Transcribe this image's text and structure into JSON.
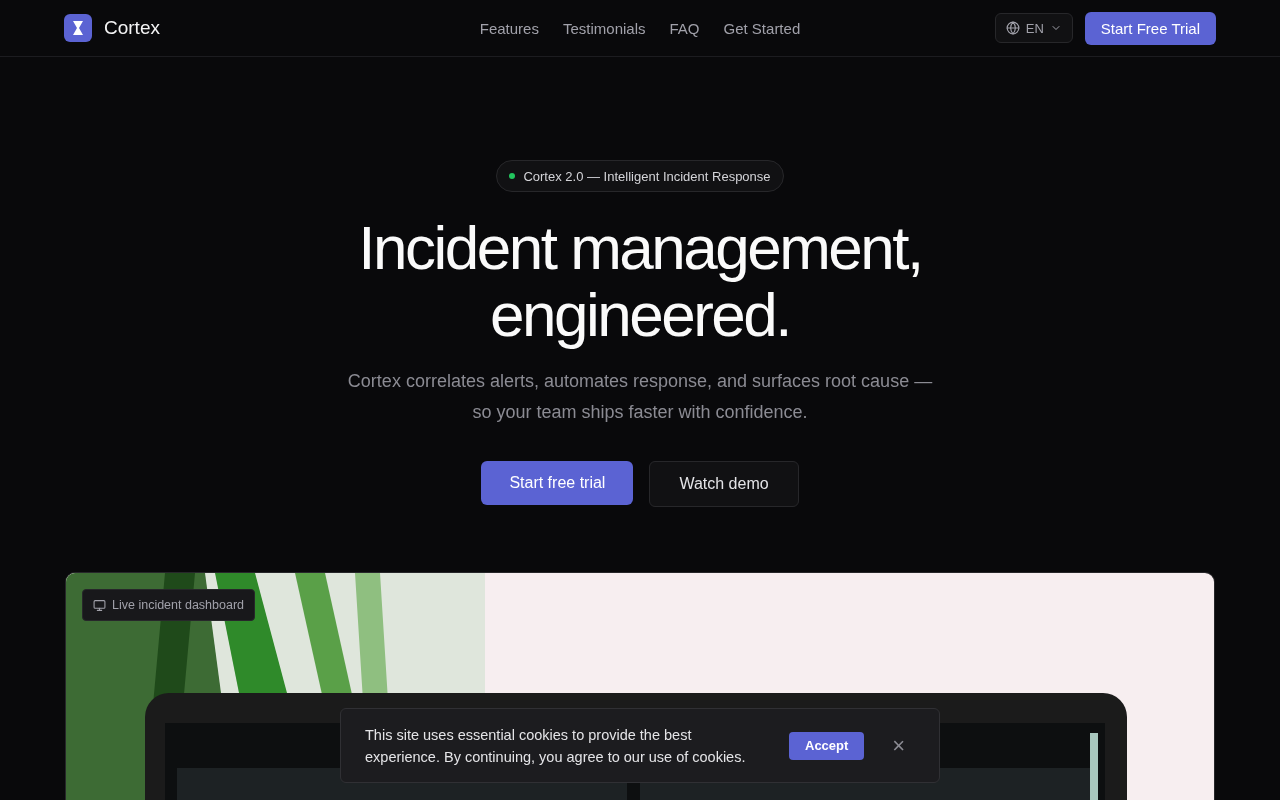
{
  "nav": {
    "brand": "Cortex",
    "links": [
      {
        "label": "Features"
      },
      {
        "label": "Testimonials"
      },
      {
        "label": "FAQ"
      },
      {
        "label": "Get Started"
      }
    ],
    "language": "EN",
    "cta": "Start Free Trial"
  },
  "hero": {
    "badge": {
      "text": "Cortex 2.0 — Intelligent Incident Response",
      "color": "#22c55e"
    },
    "title_lines": [
      "Incident management,",
      "engineered."
    ],
    "subtitle": "Cortex correlates alerts, automates response, and surfaces root cause — so your team ships faster with confidence.",
    "primary_button": "Start free trial",
    "secondary_button": "Watch demo"
  },
  "showcase": {
    "kind": "picture",
    "label": "Live incident dashboard"
  },
  "cookie_banner": {
    "text": "This site uses essential cookies to provide the best experience. By continuing, you agree to our use of cookies.",
    "accept": "Accept",
    "close": "×"
  }
}
